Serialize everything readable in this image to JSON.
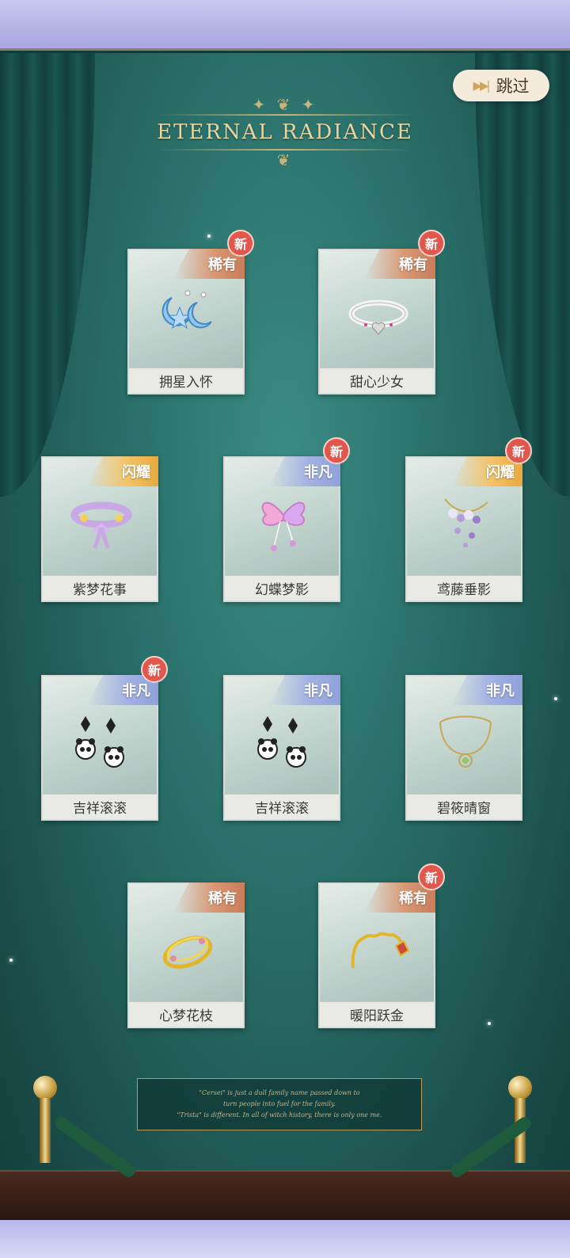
{
  "logo": {
    "title": "ETERNAL RADIANCE"
  },
  "skip": {
    "label": "跳过",
    "icon": "fast-forward-icon"
  },
  "colors": {
    "stage": "#2a6f69",
    "rare": "#c97c58",
    "super": "#8fa1da",
    "flash": "#e9a93e",
    "new_badge": "#e1574d"
  },
  "cards": [
    {
      "name": "拥星入怀",
      "rarity": "稀有",
      "rarity_type": "rare",
      "new": "新",
      "icon": "star-earrings-icon"
    },
    {
      "name": "甜心少女",
      "rarity": "稀有",
      "rarity_type": "rare",
      "new": "新",
      "icon": "heart-choker-icon"
    },
    {
      "name": "紫梦花事",
      "rarity": "闪耀",
      "rarity_type": "flash",
      "new": "",
      "icon": "flower-choker-icon"
    },
    {
      "name": "幻蝶梦影",
      "rarity": "非凡",
      "rarity_type": "super",
      "new": "新",
      "icon": "butterfly-hairpin-icon"
    },
    {
      "name": "鸢藤垂影",
      "rarity": "闪耀",
      "rarity_type": "flash",
      "new": "新",
      "icon": "wisteria-hairpin-icon"
    },
    {
      "name": "吉祥滚滚",
      "rarity": "非凡",
      "rarity_type": "super",
      "new": "新",
      "icon": "panda-earrings-icon"
    },
    {
      "name": "吉祥滚滚",
      "rarity": "非凡",
      "rarity_type": "super",
      "new": "",
      "icon": "panda-earrings-icon"
    },
    {
      "name": "碧筱晴窗",
      "rarity": "非凡",
      "rarity_type": "super",
      "new": "",
      "icon": "pendant-necklace-icon"
    },
    {
      "name": "心梦花枝",
      "rarity": "稀有",
      "rarity_type": "rare",
      "new": "",
      "icon": "gold-bangle-icon"
    },
    {
      "name": "暖阳跃金",
      "rarity": "稀有",
      "rarity_type": "rare",
      "new": "新",
      "icon": "gold-headband-icon"
    }
  ],
  "quote": {
    "line1": "\"Cersei\" is just a dull family name passed down to",
    "line2": "turn people into fuel for the family.",
    "line3": "\"Trista\" is different. In all of witch history, there is only one me."
  }
}
